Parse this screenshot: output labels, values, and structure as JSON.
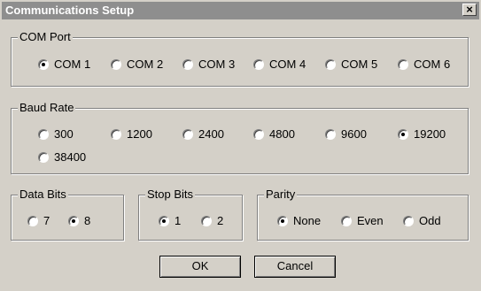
{
  "window": {
    "title": "Communications Setup",
    "close_glyph": "×"
  },
  "com_port": {
    "label": "COM Port",
    "options": [
      "COM 1",
      "COM 2",
      "COM 3",
      "COM 4",
      "COM 5",
      "COM 6"
    ],
    "selected": "COM 1"
  },
  "baud_rate": {
    "label": "Baud Rate",
    "options": [
      "300",
      "1200",
      "2400",
      "4800",
      "9600",
      "19200",
      "38400"
    ],
    "selected": "19200"
  },
  "data_bits": {
    "label": "Data Bits",
    "options": [
      "7",
      "8"
    ],
    "selected": "8"
  },
  "stop_bits": {
    "label": "Stop Bits",
    "options": [
      "1",
      "2"
    ],
    "selected": "1"
  },
  "parity": {
    "label": "Parity",
    "options": [
      "None",
      "Even",
      "Odd"
    ],
    "selected": "None"
  },
  "buttons": {
    "ok_label": "OK",
    "cancel_label": "Cancel"
  }
}
